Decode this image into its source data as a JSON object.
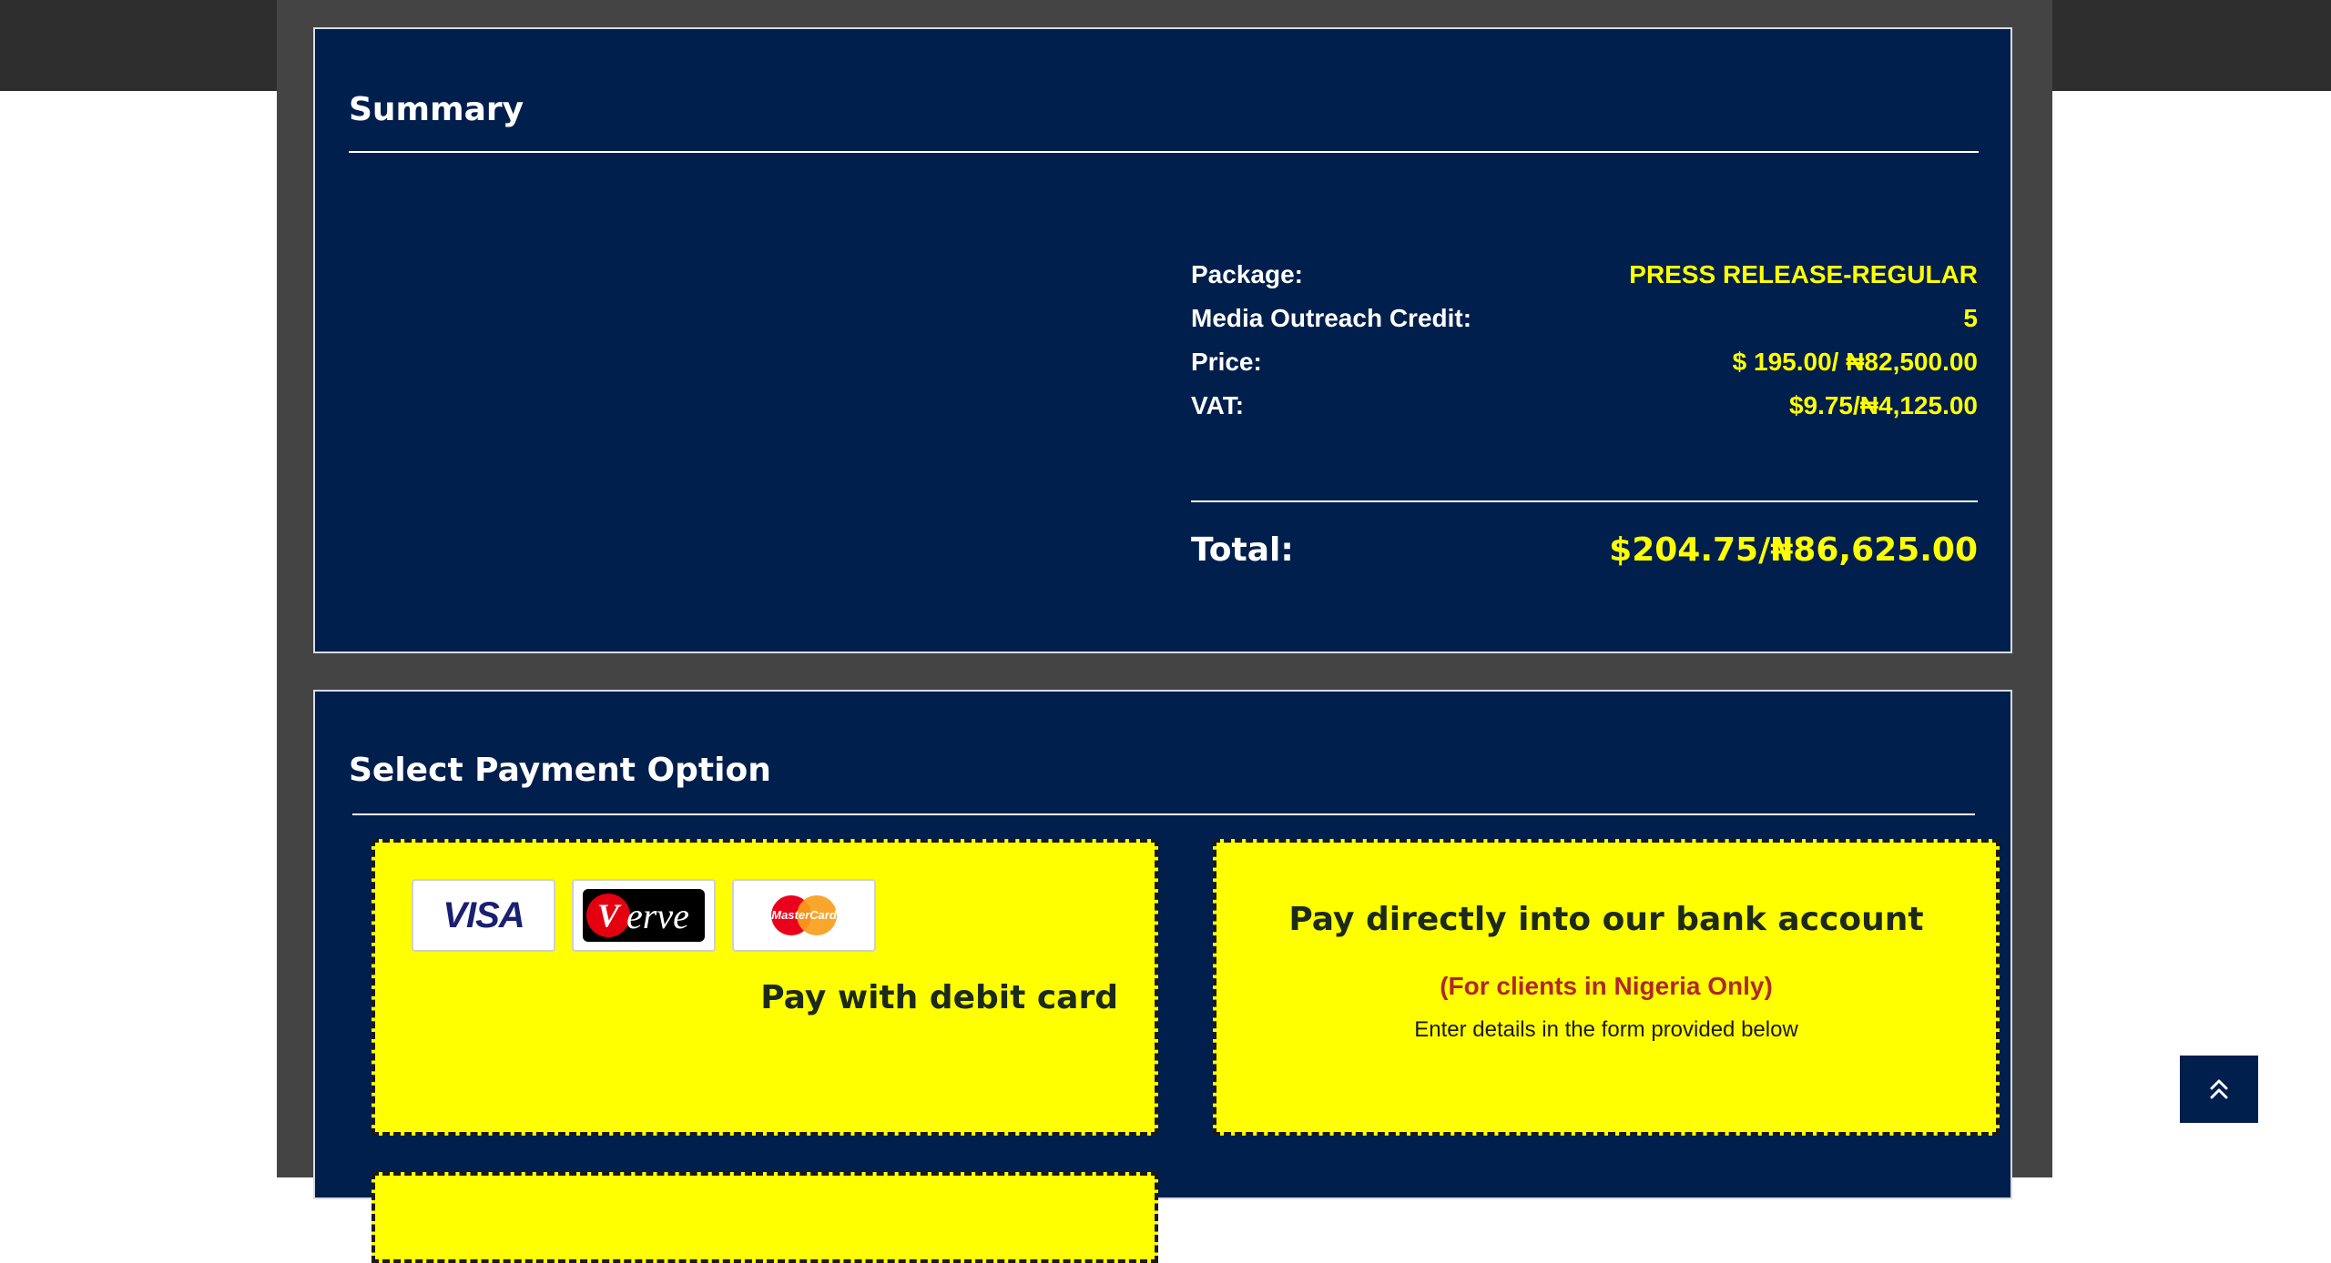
{
  "summary": {
    "title": "Summary",
    "rows": [
      {
        "label": "Package:",
        "value": "PRESS RELEASE-REGULAR"
      },
      {
        "label": "Media Outreach Credit:",
        "value": "5"
      },
      {
        "label": "Price:",
        "value": "$ 195.00/ ₦82,500.00"
      },
      {
        "label": "VAT:",
        "value": "$9.75/₦4,125.00"
      }
    ],
    "total": {
      "label": "Total:",
      "value": "$204.75/₦86,625.00"
    }
  },
  "payment": {
    "title": "Select Payment Option",
    "card_option": {
      "logos": [
        {
          "name": "visa-logo",
          "text": "VISA"
        },
        {
          "name": "verve-logo",
          "text": "erve",
          "mark": "V"
        },
        {
          "name": "mastercard-logo",
          "text": "MasterCard"
        }
      ],
      "label": "Pay with debit card"
    },
    "bank_option": {
      "title": "Pay directly into our bank account",
      "note": "(For clients in Nigeria Only)",
      "description": "Enter details in the form provided below"
    }
  },
  "back_to_top": {
    "icon": "double-chevron-up-icon"
  },
  "colors": {
    "panel_bg": "#001f4d",
    "accent_yellow": "#ffff00",
    "note_red": "#b0282a",
    "page_frame": "#444444",
    "topbar": "#2e2e2e"
  }
}
